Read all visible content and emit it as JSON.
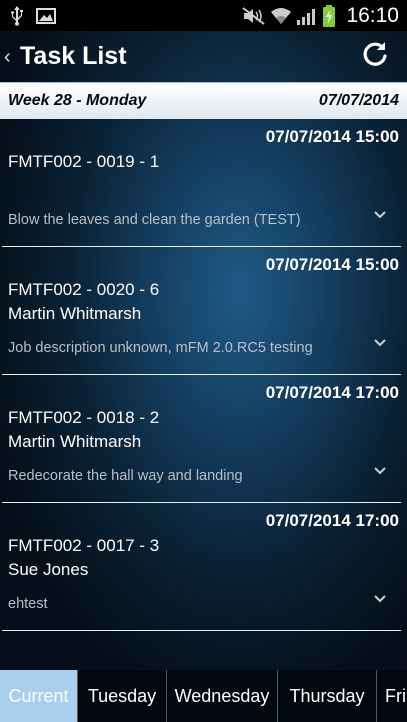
{
  "status_bar": {
    "time": "16:10",
    "icons": [
      "usb-icon",
      "image-icon",
      "mute-icon",
      "wifi-icon",
      "signal-icon",
      "battery-charging-icon"
    ]
  },
  "header": {
    "title": "Task List",
    "back_icon": "chevron-left-icon",
    "refresh_icon": "refresh-icon"
  },
  "week": {
    "label": "Week 28 - Monday",
    "date": "07/07/2014"
  },
  "tasks": [
    {
      "datetime": "07/07/2014 15:00",
      "code": "FMTF002 - 0019 - 1",
      "person": "",
      "description": "Blow the leaves and clean the garden (TEST)"
    },
    {
      "datetime": "07/07/2014 15:00",
      "code": "FMTF002 - 0020 - 6",
      "person": "Martin Whitmarsh",
      "description": "Job description unknown, mFM 2.0.RC5 testing"
    },
    {
      "datetime": "07/07/2014 17:00",
      "code": "FMTF002 - 0018 - 2",
      "person": "Martin Whitmarsh",
      "description": "Redecorate the hall way and landing"
    },
    {
      "datetime": "07/07/2014 17:00",
      "code": "FMTF002 - 0017 - 3",
      "person": "Sue Jones",
      "description": "ehtest"
    }
  ],
  "tabs": [
    {
      "label": "Current",
      "active": true
    },
    {
      "label": "Tuesday",
      "active": false
    },
    {
      "label": "Wednesday",
      "active": false
    },
    {
      "label": "Thursday",
      "active": false
    },
    {
      "label": "Fri",
      "active": false
    }
  ],
  "colors": {
    "active_tab": "#a9cdec",
    "background_glow": "#1f5a86",
    "description_text": "#b5c0c8"
  }
}
